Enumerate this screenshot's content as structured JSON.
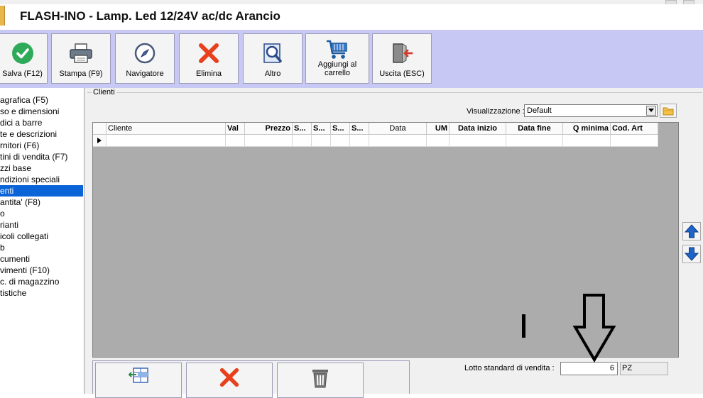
{
  "window": {
    "title": "FLASH-INO - Lamp. Led 12/24V ac/dc Arancio"
  },
  "toolbar": {
    "buttons": [
      {
        "label": "Salva (F12)",
        "icon": "check-icon"
      },
      {
        "label": "Stampa (F9)",
        "icon": "printer-icon"
      },
      {
        "label": "Navigatore",
        "icon": "compass-icon"
      },
      {
        "label": "Elimina",
        "icon": "x-icon"
      },
      {
        "label": "Altro",
        "icon": "magnifier-icon"
      },
      {
        "label": "Aggiungi al carrello",
        "icon": "cart-icon"
      },
      {
        "label": "Uscita (ESC)",
        "icon": "exit-door-icon"
      }
    ]
  },
  "sidebar": {
    "items": [
      {
        "label": "agrafica (F5)"
      },
      {
        "label": "so e dimensioni"
      },
      {
        "label": "dici a barre"
      },
      {
        "label": "te e descrizioni"
      },
      {
        "label": "rnitori (F6)"
      },
      {
        "label": "tini di vendita (F7)"
      },
      {
        "label": "zzi base"
      },
      {
        "label": "ndizioni speciali"
      },
      {
        "label": "enti"
      },
      {
        "label": "antita' (F8)"
      },
      {
        "label": "o"
      },
      {
        "label": "rianti"
      },
      {
        "label": "icoli collegati"
      },
      {
        "label": "b"
      },
      {
        "label": "cumenti"
      },
      {
        "label": "vimenti (F10)"
      },
      {
        "label": "c. di magazzino"
      },
      {
        "label": "tistiche"
      }
    ],
    "selected_index": 8
  },
  "panel": {
    "group_label": "Clienti",
    "visualizzazione_label": "Visualizzazione :",
    "visualizzazione_value": "Default"
  },
  "grid": {
    "columns": [
      "Cliente",
      "Val",
      "Prezzo",
      "S...",
      "S...",
      "S...",
      "S...",
      "Data",
      "UM",
      "Data inizio",
      "Data fine",
      "Q minima",
      "Cod. Art"
    ],
    "rows": [
      [
        "",
        "",
        "",
        "",
        "",
        "",
        "",
        "",
        "",
        "",
        "",
        "",
        ""
      ]
    ]
  },
  "footer": {
    "lotto_label": "Lotto standard di vendita :",
    "lotto_value": "6",
    "unit": "PZ"
  },
  "colors": {
    "toolbar_bg": "#c8c8f4",
    "selection": "#0a64d8",
    "green_check": "#2eaa5a",
    "red_x": "#e8401c",
    "blue_arrow": "#1e64c8"
  }
}
